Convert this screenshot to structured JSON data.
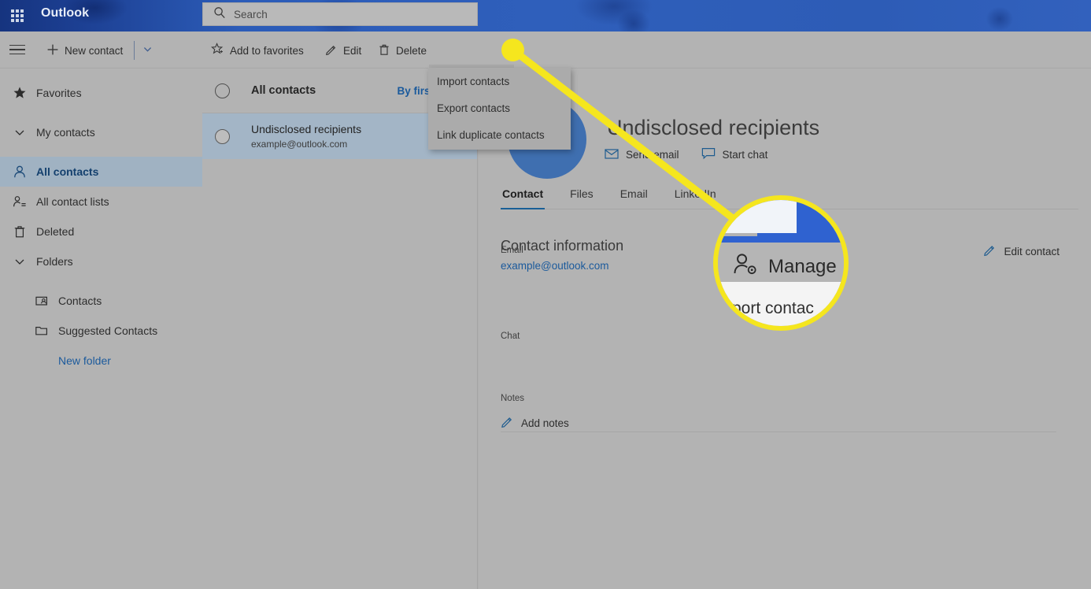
{
  "header": {
    "app_title": "Outlook",
    "waffle_icon": "app-launcher-icon",
    "search_icon": "search-icon",
    "search_placeholder": "Search",
    "search_value": ""
  },
  "toolbar": {
    "menu_icon": "hamburger-icon",
    "new_contact_label": "New contact",
    "new_contact_caret_icon": "chevron-down-icon",
    "add_to_favorites_label": "Add to favorites",
    "add_to_favorites_icon": "star-icon",
    "edit_label": "Edit",
    "edit_icon": "pencil-icon",
    "delete_label": "Delete",
    "delete_icon": "trash-icon",
    "manage_label": "Manage",
    "manage_icon": "manage-contact-icon",
    "manage_caret_icon": "chevron-down-icon"
  },
  "manage_menu": {
    "open": true,
    "items": [
      {
        "label": "Import contacts"
      },
      {
        "label": "Export contacts"
      },
      {
        "label": "Link duplicate contacts"
      }
    ]
  },
  "sidebar": {
    "items": [
      {
        "label": "Favorites",
        "icon": "star-icon",
        "indent": 0,
        "active": false,
        "link": false
      },
      {
        "label": "My contacts",
        "icon": "chevron-down-icon",
        "indent": 0,
        "active": false,
        "link": false
      },
      {
        "label": "All contacts",
        "icon": "person-icon",
        "indent": 0,
        "active": true,
        "link": false
      },
      {
        "label": "All contact lists",
        "icon": "people-list-icon",
        "indent": 0,
        "active": false,
        "link": false
      },
      {
        "label": "Deleted",
        "icon": "trash-icon",
        "indent": 0,
        "active": false,
        "link": false
      },
      {
        "label": "Folders",
        "icon": "chevron-down-icon",
        "indent": 0,
        "active": false,
        "link": false
      },
      {
        "label": "Contacts",
        "icon": "contact-card-icon",
        "indent": 1,
        "active": false,
        "link": false
      },
      {
        "label": "Suggested Contacts",
        "icon": "folder-icon",
        "indent": 1,
        "active": false,
        "link": false
      },
      {
        "label": "New folder",
        "icon": "none",
        "indent": 1,
        "active": false,
        "link": true
      }
    ]
  },
  "list_pane": {
    "header_title": "All contacts",
    "sort_label": "By first name",
    "contacts": [
      {
        "name": "Undisclosed recipients",
        "email": "example@outlook.com",
        "selected": true
      }
    ]
  },
  "detail": {
    "name": "Undisclosed recipients",
    "avatar_icon": "avatar-circle",
    "actions": [
      {
        "label": "Send email",
        "icon": "envelope-icon"
      },
      {
        "label": "Start chat",
        "icon": "chat-bubble-icon"
      }
    ],
    "tabs": [
      {
        "label": "Contact",
        "active": true
      },
      {
        "label": "Files",
        "active": false
      },
      {
        "label": "Email",
        "active": false
      },
      {
        "label": "LinkedIn",
        "active": false
      }
    ],
    "section_title": "Contact information",
    "edit_contact_label": "Edit contact",
    "edit_contact_icon": "pencil-icon",
    "fields": {
      "email_label": "Email",
      "email_value": "example@outlook.com",
      "chat_label": "Chat",
      "notes_label": "Notes",
      "add_notes_label": "Add notes",
      "add_notes_icon": "pencil-icon"
    }
  },
  "annotation": {
    "highlight_color": "#f5e61e",
    "callout_manage_label": "Manage",
    "callout_menu_text": "port contac",
    "callout_caret_icon": "chevron-down-icon",
    "callout_manage_icon": "manage-contact-icon"
  },
  "colors": {
    "header_blue": "#2f5fbb",
    "accent_blue": "#1b5a9c",
    "selection_blue": "#a3b5c6",
    "surface_gray": "#b3b3b3",
    "highlight_yellow": "#f5e61e"
  }
}
